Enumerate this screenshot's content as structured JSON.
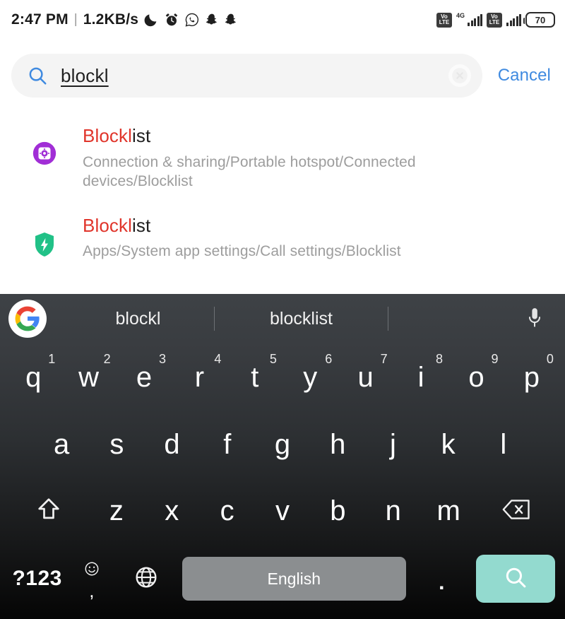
{
  "status_bar": {
    "time": "2:47 PM",
    "separator": "|",
    "network_speed": "1.2KB/s",
    "icons": [
      "moon-icon",
      "alarm-icon",
      "whatsapp-icon",
      "snapchat-icon",
      "snapchat-icon"
    ],
    "volte_top": "Vo",
    "volte_bottom": "LTE",
    "network_type": "4G",
    "battery_level": "70"
  },
  "search": {
    "value": "blockl",
    "cancel_label": "Cancel",
    "search_icon_color": "#3f8ae0",
    "cancel_color": "#3f8ae0"
  },
  "results": [
    {
      "title_highlight": "Blockl",
      "title_rest": "ist",
      "path": "Connection & sharing/Portable hotspot/Connected devices/Blocklist",
      "icon": "settings-gear-icon",
      "icon_color": "#a12ed6"
    },
    {
      "title_highlight": "Blockl",
      "title_rest": "ist",
      "path": "Apps/System app settings/Call settings/Blocklist",
      "icon": "shield-bolt-icon",
      "icon_color": "#21c187"
    }
  ],
  "keyboard": {
    "suggestions": [
      "blockl",
      "blocklist"
    ],
    "logo": "google-logo",
    "mic_icon": "microphone-icon",
    "row1": [
      {
        "letter": "q",
        "number": "1"
      },
      {
        "letter": "w",
        "number": "2"
      },
      {
        "letter": "e",
        "number": "3"
      },
      {
        "letter": "r",
        "number": "4"
      },
      {
        "letter": "t",
        "number": "5"
      },
      {
        "letter": "y",
        "number": "6"
      },
      {
        "letter": "u",
        "number": "7"
      },
      {
        "letter": "i",
        "number": "8"
      },
      {
        "letter": "o",
        "number": "9"
      },
      {
        "letter": "p",
        "number": "0"
      }
    ],
    "row2": [
      {
        "letter": "a"
      },
      {
        "letter": "s"
      },
      {
        "letter": "d"
      },
      {
        "letter": "f"
      },
      {
        "letter": "g"
      },
      {
        "letter": "h"
      },
      {
        "letter": "j"
      },
      {
        "letter": "k"
      },
      {
        "letter": "l"
      }
    ],
    "row3": [
      {
        "letter": "z"
      },
      {
        "letter": "x"
      },
      {
        "letter": "c"
      },
      {
        "letter": "v"
      },
      {
        "letter": "b"
      },
      {
        "letter": "n"
      },
      {
        "letter": "m"
      }
    ],
    "shift_icon": "shift-arrow-icon",
    "backspace_icon": "backspace-icon",
    "symbols_label": "?123",
    "comma_label": ",",
    "emoji_icon": "emoji-smiley-icon",
    "globe_icon": "language-globe-icon",
    "space_label": "English",
    "period_label": ".",
    "enter_icon": "search-magnifier-icon",
    "enter_key_color": "#93dacf",
    "space_key_color": "#8b8e90"
  }
}
